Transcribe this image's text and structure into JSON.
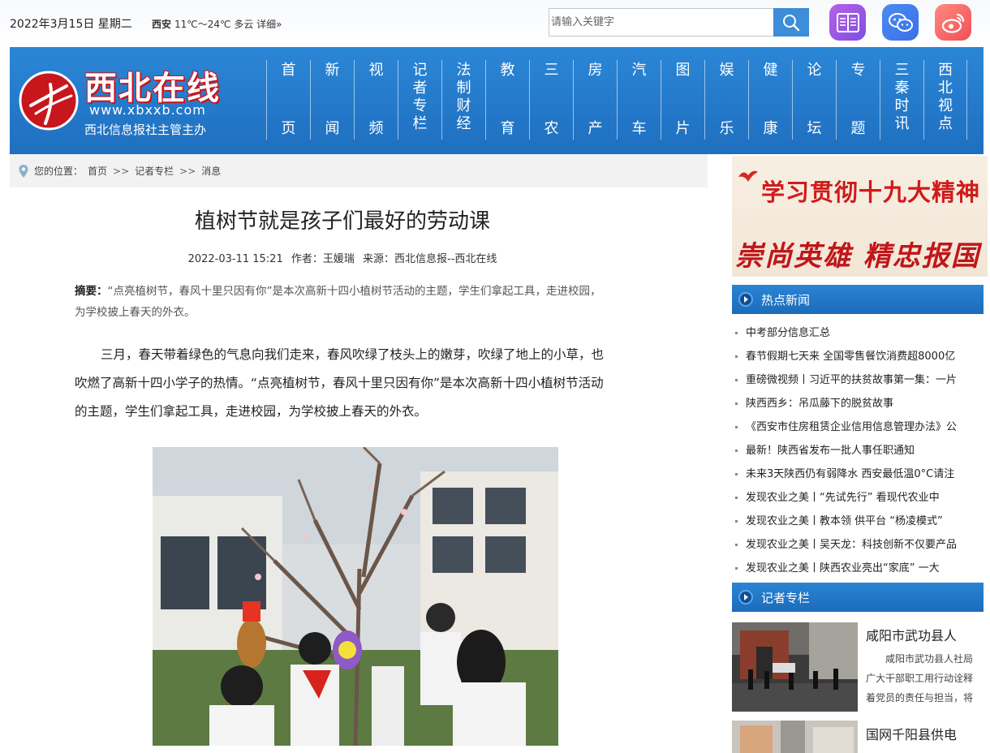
{
  "topbar": {
    "date": "2022年3月15日 星期二",
    "weather_city": "西安",
    "weather_text": "11℃～24℃ 多云 详细»",
    "search_placeholder": "请输入关键字"
  },
  "header": {
    "site_name": "西北在线",
    "site_url": "www.xbxxb.com",
    "site_sub": "西北信息报社主管主办"
  },
  "nav": [
    {
      "label": "首页",
      "top": "首",
      "bottom": "页"
    },
    {
      "label": "新闻",
      "top": "新",
      "bottom": "闻"
    },
    {
      "label": "视频",
      "top": "视",
      "bottom": "频"
    },
    {
      "label": "记者专栏",
      "stack": [
        "记",
        "者",
        "专",
        "栏"
      ]
    },
    {
      "label": "法制财经",
      "stack": [
        "法",
        "制",
        "财",
        "经"
      ]
    },
    {
      "label": "教育",
      "top": "教",
      "bottom": "育"
    },
    {
      "label": "三农",
      "top": "三",
      "bottom": "农"
    },
    {
      "label": "房产",
      "top": "房",
      "bottom": "产"
    },
    {
      "label": "汽车",
      "top": "汽",
      "bottom": "车"
    },
    {
      "label": "图片",
      "top": "图",
      "bottom": "片"
    },
    {
      "label": "娱乐",
      "top": "娱",
      "bottom": "乐"
    },
    {
      "label": "健康",
      "top": "健",
      "bottom": "康"
    },
    {
      "label": "论坛",
      "top": "论",
      "bottom": "坛"
    },
    {
      "label": "专题",
      "top": "专",
      "bottom": "题"
    },
    {
      "label": "三秦时讯",
      "stack": [
        "三",
        "秦",
        "时",
        "讯"
      ]
    },
    {
      "label": "西北视点",
      "stack": [
        "西",
        "北",
        "视",
        "点"
      ]
    }
  ],
  "breadcrumb": {
    "prefix": "您的位置：",
    "items": [
      "首页",
      "记者专栏",
      "消息"
    ],
    "separator": ">>"
  },
  "article": {
    "title": "植树节就是孩子们最好的劳动课",
    "datetime": "2022-03-11 15:21",
    "author_label": "作者：王媛瑞",
    "source_label": "来源：西北信息报--西北在线",
    "abstract_label": "摘要：",
    "abstract_text": "“点亮植树节，春风十里只因有你”是本次高新十四小植树节活动的主题，学生们拿起工具，走进校园，为学校披上春天的外衣。",
    "body": "三月，春天带着绿色的气息向我们走来，春风吹绿了枝头上的嫩芽，吹绿了地上的小草，也吹燃了高新十四小学子的热情。“点亮植树节，春风十里只因有你”是本次高新十四小植树节活动的主题，学生们拿起工具，走进校园，为学校披上春天的外衣。"
  },
  "banner": {
    "line1": "学习贯彻十九大精神",
    "line2": "崇尚英雄 精忠报国"
  },
  "hot_news": {
    "heading": "热点新闻",
    "items": [
      "中考部分信息汇总",
      "春节假期七天来 全国零售餐饮消费超8000亿",
      "重磅微视频丨习近平的扶贫故事第一集：一片",
      "陕西西乡：吊瓜藤下的脱贫故事",
      "《西安市住房租赁企业信用信息管理办法》公",
      "最新！陕西省发布一批人事任职通知",
      "未来3天陕西仍有弱降水 西安最低温0°C请注",
      "发现农业之美丨“先试先行” 看现代农业中",
      "发现农业之美丨教本领 供平台 “杨凌模式”",
      "发现农业之美丨吴天龙：科技创新不仅要产品",
      "发现农业之美丨陕西农业亮出“家底” 一大"
    ]
  },
  "reporter": {
    "heading": "记者专栏",
    "item1_title": "咸阳市武功县人",
    "item1_desc": "咸阳市武功县人社局广大干部职工用行动诠释着党员的责任与担当，将",
    "item2_title": "国网千阳县供电"
  },
  "colors": {
    "header_blue": "#1f6fc0",
    "search_button": "#3b8ed7",
    "brand_red": "#c8161d"
  }
}
